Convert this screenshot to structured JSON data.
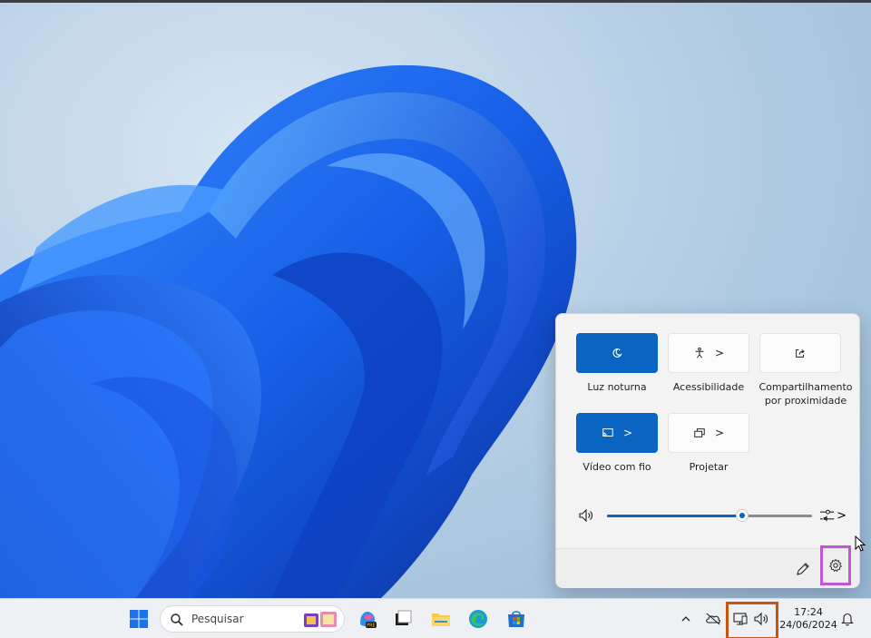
{
  "quick_settings": {
    "tiles": [
      {
        "label": "Luz noturna",
        "icon": "night-light-icon",
        "active": true,
        "has_chevron": false
      },
      {
        "label": "Acessibilidade",
        "icon": "accessibility-icon",
        "active": false,
        "has_chevron": true
      },
      {
        "label": "Compartilhamento por proximidade",
        "label_line1": "Compartilhamento",
        "label_line2": "por proximidade",
        "icon": "share-icon",
        "active": false,
        "has_chevron": false
      },
      {
        "label": "Vídeo com fio",
        "icon": "cast-icon",
        "active": true,
        "has_chevron": true
      },
      {
        "label": "Projetar",
        "icon": "project-icon",
        "active": false,
        "has_chevron": true
      }
    ],
    "volume": {
      "level": 0.66,
      "icon": "speaker-icon"
    },
    "chevron": ">",
    "footer": {
      "edit_icon": "pencil-icon",
      "settings_icon": "gear-icon"
    }
  },
  "taskbar": {
    "start_icon": "windows-logo-icon",
    "search_placeholder": "Pesquisar",
    "pinned_apps": [
      "copilot-icon",
      "terminal-icon",
      "file-explorer-icon",
      "edge-icon",
      "store-icon"
    ],
    "tray_icons": [
      "chevron-up-icon",
      "onedrive-offline-icon",
      "network-icon",
      "volume-icon",
      "bell-icon"
    ],
    "time": "17:24",
    "date": "24/06/2024"
  },
  "colors": {
    "accent": "#0a64c2",
    "highlight_settings": "#c058d6",
    "highlight_tray": "#c9530f"
  }
}
